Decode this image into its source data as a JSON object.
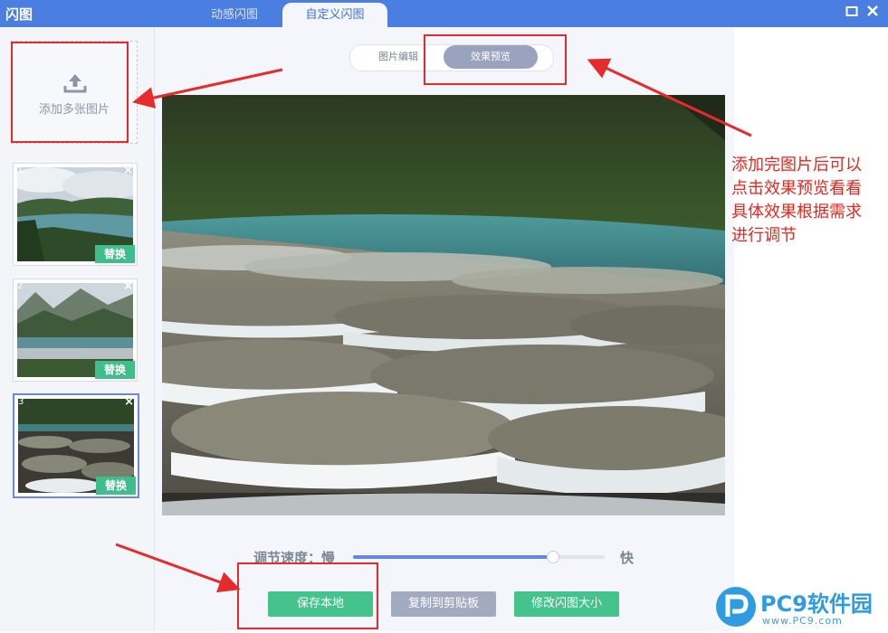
{
  "window": {
    "title": "闪图",
    "maximize_icon": "maximize-icon",
    "close_icon": "close-icon"
  },
  "tabs": [
    {
      "label": "动感闪图",
      "active": false
    },
    {
      "label": "自定义闪图",
      "active": true
    }
  ],
  "sidebar": {
    "add_label": "添加多张图片",
    "thumbnails": [
      {
        "index": "1",
        "replace_label": "替换",
        "close": "×",
        "selected": false
      },
      {
        "index": "2",
        "replace_label": "替换",
        "close": "×",
        "selected": false
      },
      {
        "index": "3",
        "replace_label": "替换",
        "close": "×",
        "selected": true
      }
    ]
  },
  "view_toggle": {
    "edit_label": "图片编辑",
    "preview_label": "效果预览",
    "active": "效果预览"
  },
  "speed": {
    "label": "调节速度：慢",
    "fast_label": "快",
    "value": 0.79
  },
  "buttons": {
    "save": "保存本地",
    "copy": "复制到剪贴板",
    "resize": "修改闪图大小"
  },
  "annotation": {
    "line1": "添加完图片后可以",
    "line2": "点击效果预览看看",
    "line3": "具体效果根据需求",
    "line4": "进行调节"
  },
  "watermark": {
    "brand": "PC9软件园",
    "url": "www.PC9.com"
  },
  "colors": {
    "title_bar": "#4a7ee0",
    "accent_green": "#45c38c",
    "annotation_red": "#e52b2b"
  }
}
